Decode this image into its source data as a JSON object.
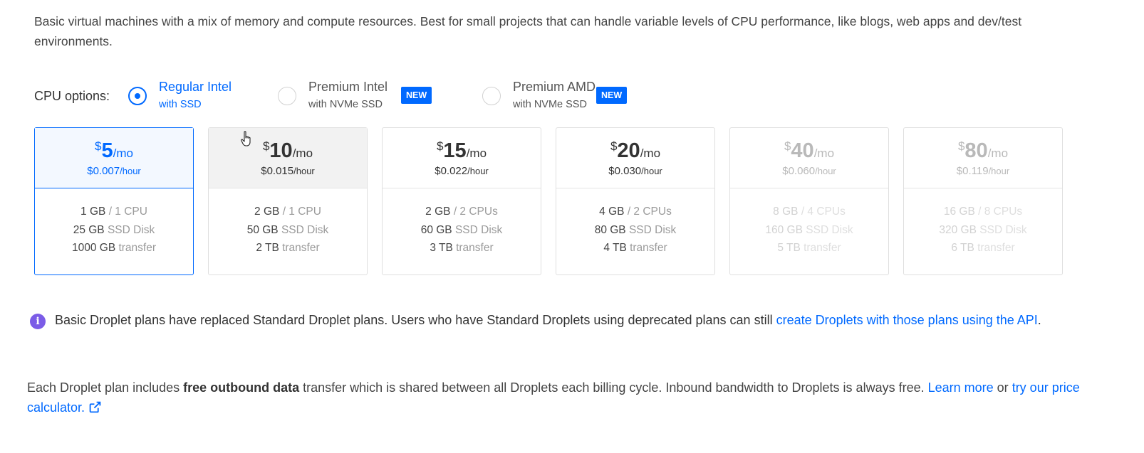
{
  "intro_text": "Basic virtual machines with a mix of memory and compute resources. Best for small projects that can handle variable levels of CPU performance, like blogs, web apps and dev/test environments.",
  "cpu_options": {
    "label": "CPU options:",
    "options": [
      {
        "title": "Regular Intel",
        "subtitle": "with SSD",
        "selected": true
      },
      {
        "title": "Premium Intel",
        "subtitle": "with NVMe SSD",
        "badge": "NEW",
        "selected": false
      },
      {
        "title": "Premium AMD",
        "subtitle": "with NVMe SSD",
        "badge": "NEW",
        "selected": false
      }
    ]
  },
  "plans": [
    {
      "currency": "$",
      "price": "5",
      "per": "/mo",
      "hourly": "$0.007",
      "hourly_unit": "/hour",
      "memory": "1 GB",
      "cpu": "/ 1 CPU",
      "disk": "25 GB",
      "disk_label": "SSD Disk",
      "transfer": "1000 GB",
      "transfer_label": "transfer",
      "state": "selected"
    },
    {
      "currency": "$",
      "price": "10",
      "per": "/mo",
      "hourly": "$0.015",
      "hourly_unit": "/hour",
      "memory": "2 GB",
      "cpu": "/ 1 CPU",
      "disk": "50 GB",
      "disk_label": "SSD Disk",
      "transfer": "2 TB",
      "transfer_label": "transfer",
      "state": "hover"
    },
    {
      "currency": "$",
      "price": "15",
      "per": "/mo",
      "hourly": "$0.022",
      "hourly_unit": "/hour",
      "memory": "2 GB",
      "cpu": "/ 2 CPUs",
      "disk": "60 GB",
      "disk_label": "SSD Disk",
      "transfer": "3 TB",
      "transfer_label": "transfer",
      "state": "normal"
    },
    {
      "currency": "$",
      "price": "20",
      "per": "/mo",
      "hourly": "$0.030",
      "hourly_unit": "/hour",
      "memory": "4 GB",
      "cpu": "/ 2 CPUs",
      "disk": "80 GB",
      "disk_label": "SSD Disk",
      "transfer": "4 TB",
      "transfer_label": "transfer",
      "state": "normal"
    },
    {
      "currency": "$",
      "price": "40",
      "per": "/mo",
      "hourly": "$0.060",
      "hourly_unit": "/hour",
      "memory": "8 GB",
      "cpu": "/ 4 CPUs",
      "disk": "160 GB",
      "disk_label": "SSD Disk",
      "transfer": "5 TB",
      "transfer_label": "transfer",
      "state": "disabled"
    },
    {
      "currency": "$",
      "price": "80",
      "per": "/mo",
      "hourly": "$0.119",
      "hourly_unit": "/hour",
      "memory": "16 GB",
      "cpu": "/ 8 CPUs",
      "disk": "320 GB",
      "disk_label": "SSD Disk",
      "transfer": "6 TB",
      "transfer_label": "transfer",
      "state": "disabled"
    }
  ],
  "info": {
    "text": "Basic Droplet plans have replaced Standard Droplet plans. Users who have Standard Droplets using deprecated plans can still ",
    "link": "create Droplets with those plans using the API",
    "suffix": "."
  },
  "footer": {
    "text1": "Each Droplet plan includes ",
    "bold": "free outbound data",
    "text2": " transfer which is shared between all Droplets each billing cycle. Inbound bandwidth to Droplets is always free. ",
    "learn_more": "Learn more",
    "or": " or ",
    "calculator": "try our price calculator."
  },
  "colors": {
    "accent": "#0069ff",
    "info_icon": "#7b5ce7"
  },
  "icons": {
    "info": "info-icon",
    "external": "external-link-icon",
    "cursor": "hand-pointer-cursor"
  }
}
